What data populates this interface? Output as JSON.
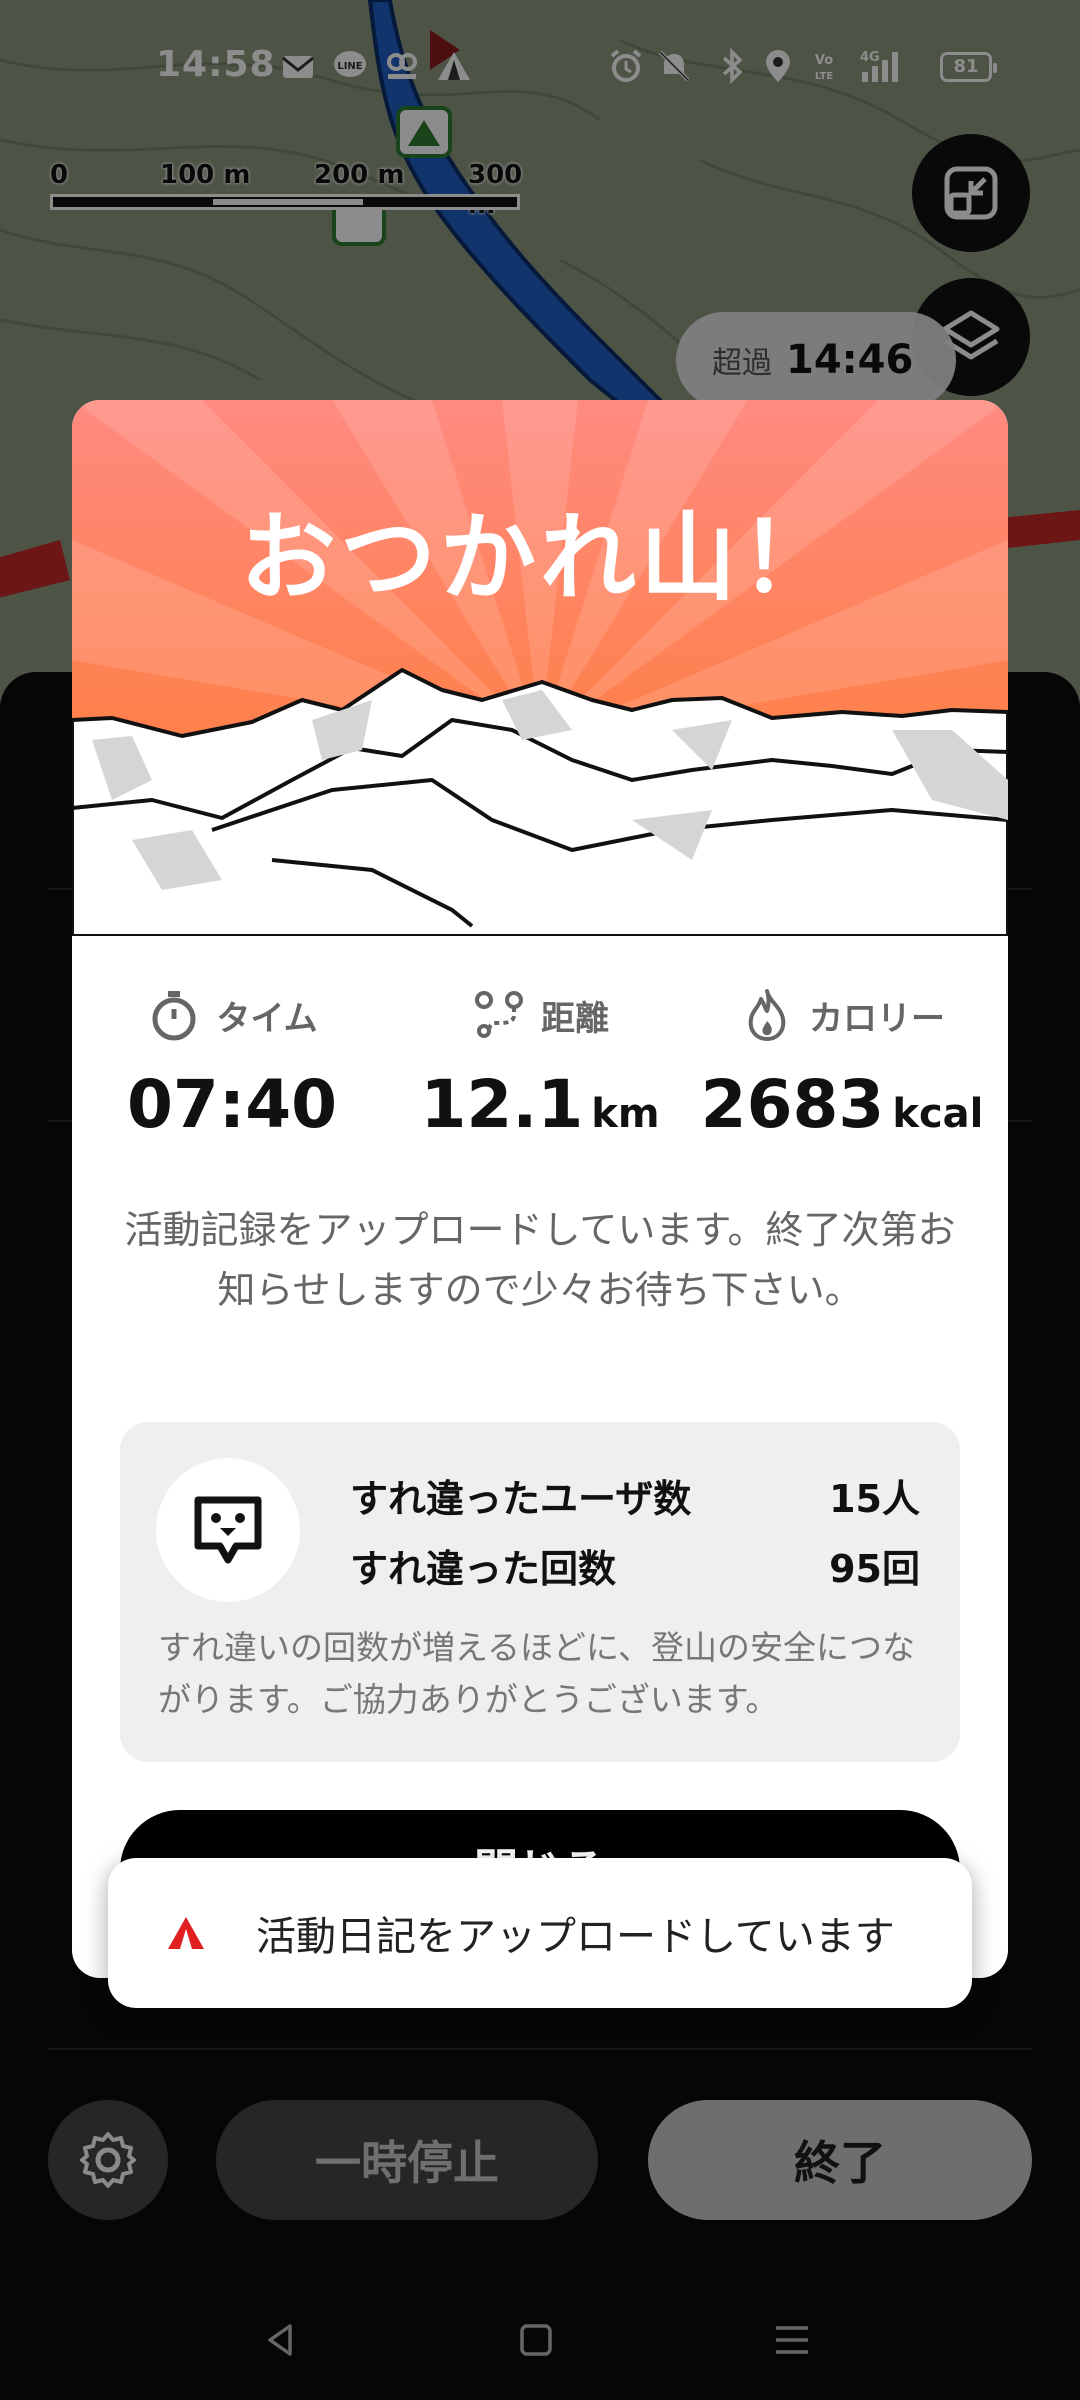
{
  "status_bar": {
    "time": "14:58",
    "battery": "81",
    "notification_icons": [
      "mail-icon",
      "line-icon",
      "centx-icon",
      "yamap-icon"
    ],
    "system_icons": [
      "alarm-icon",
      "mute-icon",
      "bluetooth-icon",
      "location-icon",
      "volte-icon",
      "signal-4g-icon"
    ]
  },
  "map": {
    "scale_labels": [
      "0",
      "100 m",
      "200 m",
      "300 m"
    ],
    "overtime_label": "超過",
    "overtime_value": "14:46"
  },
  "modal": {
    "title": "おつかれ山！",
    "stats": [
      {
        "icon": "stopwatch-icon",
        "label": "タイム",
        "value": "07:40",
        "unit": ""
      },
      {
        "icon": "route-icon",
        "label": "距離",
        "value": "12.1",
        "unit": "km"
      },
      {
        "icon": "flame-icon",
        "label": "カロリー",
        "value": "2683",
        "unit": "kcal"
      }
    ],
    "upload_message": "活動記録をアップロードしています。終了次第お知らせしますので少々お待ち下さい。",
    "passing": {
      "users_label": "すれ違ったユーザ数",
      "users_value": "15人",
      "count_label": "すれ違った回数",
      "count_value": "95回",
      "note": "すれ違いの回数が増えるほどに、登山の安全につながります。ご協力ありがとうございます。"
    },
    "close_label": "閉じる"
  },
  "toast": {
    "text": "活動日記をアップロードしています"
  },
  "bottom_controls": {
    "pause_label": "一時停止",
    "end_label": "終了"
  },
  "colors": {
    "hero_top": "#ff8a80",
    "hero_bottom": "#ff7a2a",
    "brand_red": "#e02020"
  }
}
